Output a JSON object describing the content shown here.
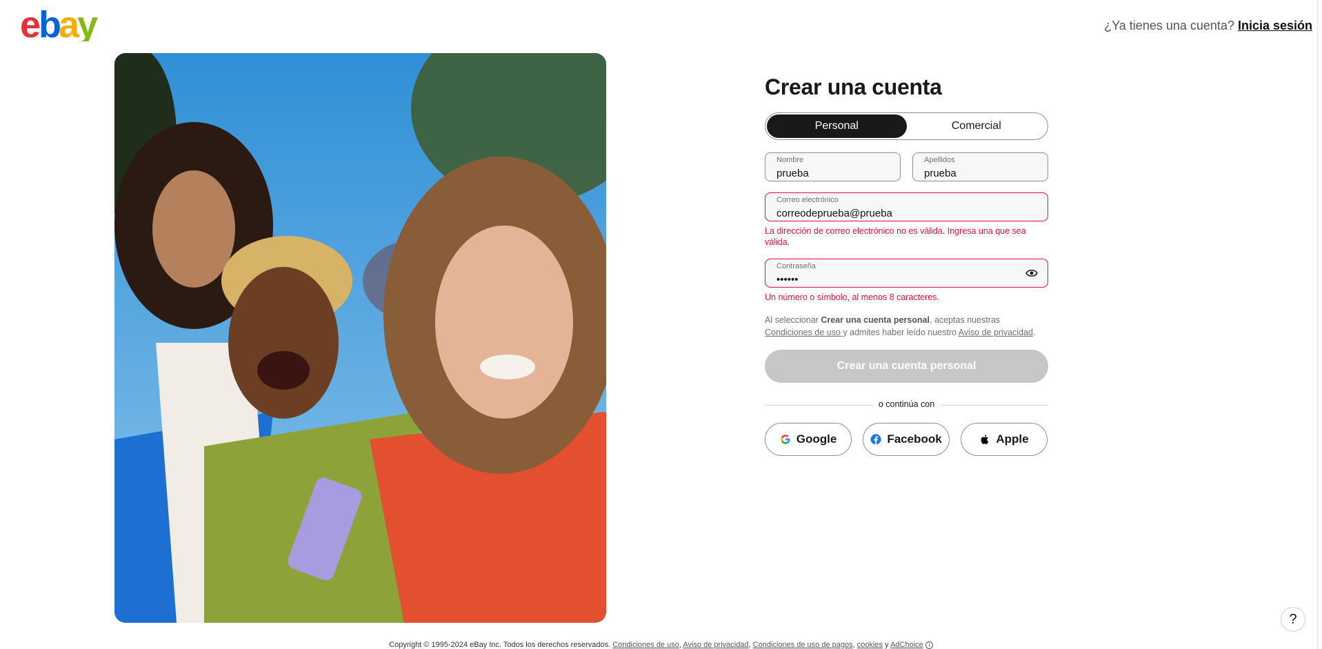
{
  "header": {
    "logo_letters": [
      "e",
      "b",
      "a",
      "y"
    ],
    "logo_colors": [
      "#e53238",
      "#0064d2",
      "#f5af02",
      "#86b817"
    ],
    "signin_prompt": "¿Ya tienes una cuenta?",
    "signin_link": "Inicia sesión"
  },
  "form": {
    "title": "Crear una cuenta",
    "tabs": [
      {
        "label": "Personal",
        "selected": true
      },
      {
        "label": "Comercial",
        "selected": false
      }
    ],
    "first_name": {
      "label": "Nombre",
      "value": "prueba"
    },
    "last_name": {
      "label": "Apellidos",
      "value": "prueba"
    },
    "email": {
      "label": "Correo electrónico",
      "value": "correodeprueba@prueba",
      "error": "La dirección de correo electrónico no es válida. Ingresa una que sea válida."
    },
    "password": {
      "label": "Contraseña",
      "value": "••••••",
      "error": "Un número o símbolo, al menos 8 caracteres."
    },
    "legal": {
      "prefix": "Al seleccionar ",
      "bold": "Crear una cuenta personal",
      "mid1": ", aceptas nuestras ",
      "terms_link": "Condiciones de uso ",
      "mid2": "y admites haber leído nuestro ",
      "privacy_link": "Aviso de privacidad",
      "suffix": "."
    },
    "submit_label": "Crear una cuenta personal",
    "divider_text": "o continúa con",
    "social": {
      "google": "Google",
      "facebook": "Facebook",
      "apple": "Apple"
    }
  },
  "footer": {
    "copyright": "Copyright © 1995-2024 eBay Inc. Todos los derechos reservados.",
    "links": [
      "Condiciones de uso",
      "Aviso de privacidad",
      "Condiciones de uso de pagos",
      "cookies",
      "AdChoice"
    ],
    "and": "y"
  },
  "help_label": "?",
  "colors": {
    "error": "#e0103a",
    "primary_disabled": "#c7c7c7",
    "tab_active": "#191919"
  }
}
